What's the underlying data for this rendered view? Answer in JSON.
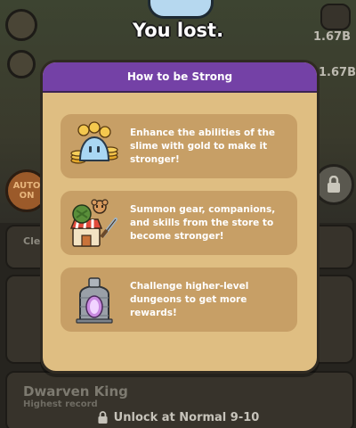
{
  "result": {
    "title": "You lost."
  },
  "background": {
    "value_top": "1.67B",
    "value_mid": "1.67B",
    "auto_button": "AUTO\nON",
    "left_partial_1": "Cle",
    "dungeon_name": "Dwarven King",
    "dungeon_sub": "Highest record",
    "unlock_text": "Unlock at Normal 9-10"
  },
  "modal": {
    "title": "How to be Strong",
    "tips": [
      {
        "icon": "slime-gold-icon",
        "text": "Enhance the abilities of the slime with gold to make it stronger!"
      },
      {
        "icon": "store-companion-icon",
        "text": "Summon gear, companions, and skills from the store to become stronger!"
      },
      {
        "icon": "dungeon-portal-icon",
        "text": "Challenge higher-level dungeons to get more rewards!"
      }
    ]
  },
  "colors": {
    "header": "#7441a6",
    "panel": "#dfbe82",
    "tip_card": "#c79f66"
  }
}
